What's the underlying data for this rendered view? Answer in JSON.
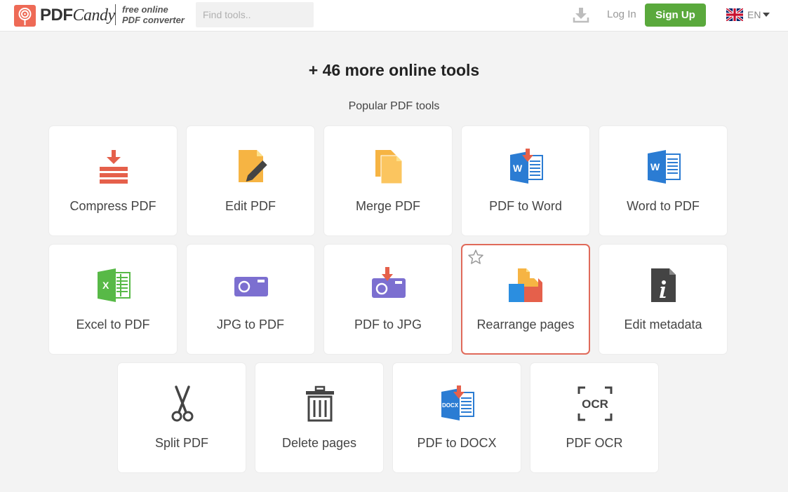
{
  "header": {
    "logo": {
      "pdf": "PDF",
      "candy": "Candy"
    },
    "tagline": [
      "free online",
      "PDF converter"
    ],
    "search_placeholder": "Find tools..",
    "login_label": "Log In",
    "signup_label": "Sign Up",
    "language_code": "EN"
  },
  "main": {
    "title": "+ 46 more online tools",
    "subtitle": "Popular PDF tools",
    "tools": [
      {
        "label": "Compress PDF",
        "icon": "compress-icon"
      },
      {
        "label": "Edit PDF",
        "icon": "edit-pdf-icon"
      },
      {
        "label": "Merge PDF",
        "icon": "merge-icon"
      },
      {
        "label": "PDF to Word",
        "icon": "pdf-to-word-icon"
      },
      {
        "label": "Word to PDF",
        "icon": "word-icon"
      },
      {
        "label": "Excel to PDF",
        "icon": "excel-icon"
      },
      {
        "label": "JPG to PDF",
        "icon": "jpg-icon"
      },
      {
        "label": "PDF to JPG",
        "icon": "pdf-to-jpg-icon"
      },
      {
        "label": "Rearrange pages",
        "icon": "rearrange-icon",
        "highlighted": true
      },
      {
        "label": "Edit metadata",
        "icon": "metadata-icon"
      },
      {
        "label": "Split PDF",
        "icon": "scissors-icon"
      },
      {
        "label": "Delete pages",
        "icon": "trash-icon"
      },
      {
        "label": "PDF to DOCX",
        "icon": "pdf-to-docx-icon"
      },
      {
        "label": "PDF OCR",
        "icon": "ocr-icon"
      }
    ]
  },
  "colors": {
    "brand_red": "#ee6a56",
    "signup_green": "#5aa93c",
    "highlight_border": "#e06a5a"
  }
}
